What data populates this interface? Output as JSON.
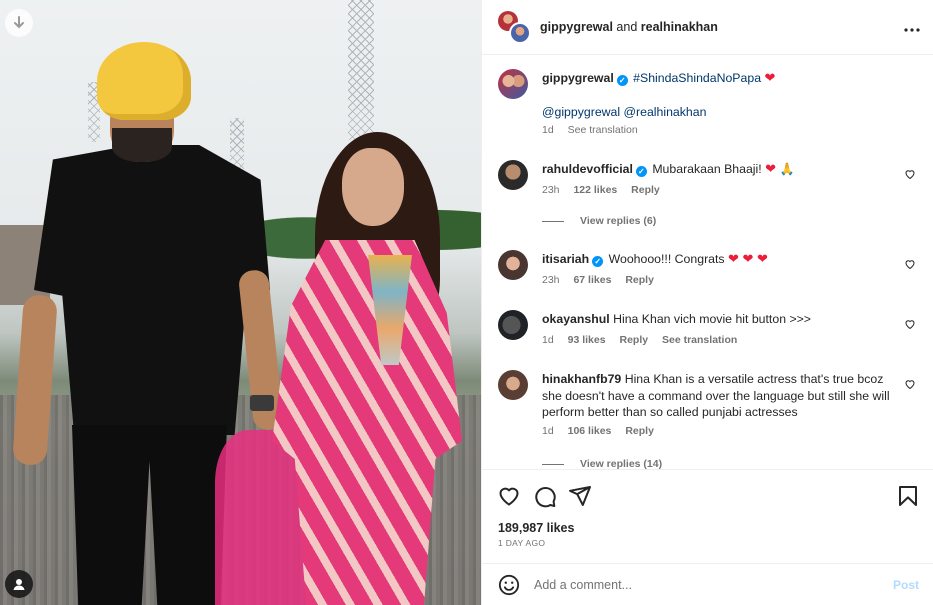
{
  "header": {
    "user1": "gippygrewal",
    "joiner": "and",
    "user2": "realhinakhan"
  },
  "caption": {
    "username": "gippygrewal",
    "hashtag": "#ShindaShindaNoPapa",
    "mention1": "@gippygrewal",
    "mention2": "@realhinakhan",
    "time": "1d",
    "see_translation": "See translation"
  },
  "comments": [
    {
      "username": "rahuldevofficial",
      "verified": true,
      "text": "Mubarakaan Bhaaji!",
      "time": "23h",
      "likes": "122 likes",
      "reply": "Reply",
      "view_replies": "View replies (6)"
    },
    {
      "username": "itisariah",
      "verified": true,
      "text": "Woohooo!!! Congrats",
      "time": "23h",
      "likes": "67 likes",
      "reply": "Reply"
    },
    {
      "username": "okayanshul",
      "verified": false,
      "text": "Hina Khan vich movie hit button >>>",
      "time": "1d",
      "likes": "93 likes",
      "reply": "Reply",
      "see_translation": "See translation"
    },
    {
      "username": "hinakhanfb79",
      "verified": false,
      "text": "Hina Khan is a versatile actress that's true bcoz she doesn't have a command over the language but still she will perform better than so called punjabi actresses",
      "time": "1d",
      "likes": "106 likes",
      "reply": "Reply",
      "view_replies": "View replies (14)"
    }
  ],
  "footer": {
    "likes": "189,987 likes",
    "time_ago": "1 DAY AGO",
    "comment_placeholder": "Add a comment...",
    "post_label": "Post"
  },
  "icons": {
    "download": "arrow-down-icon",
    "tag": "user-tag-icon",
    "more": "more-horizontal-icon",
    "like": "heart-icon",
    "comment": "comment-icon",
    "share": "send-icon",
    "save": "bookmark-icon",
    "emoji": "smile-icon"
  },
  "colors": {
    "link": "#00376b",
    "verified": "#0095f6",
    "post_disabled": "#b3dbff",
    "heart_emoji": "#ed1c39"
  }
}
